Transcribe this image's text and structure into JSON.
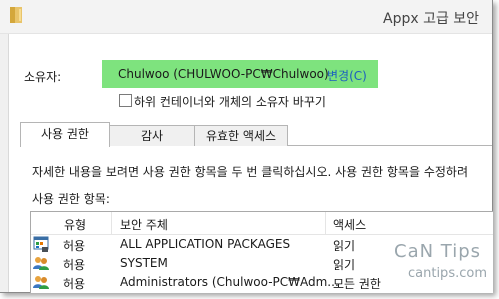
{
  "window": {
    "title": "Appx 고급 보안"
  },
  "owner": {
    "label": "소유자:",
    "value": "Chulwoo (CHULWOO-PC₩Chulwoo)",
    "change_link": "변경(C)",
    "highlight_color": "#7ee37e"
  },
  "replace_owner_checkbox": {
    "label": "하위 컨테이너와 개체의 소유자 바꾸기",
    "checked": false
  },
  "tabs": [
    {
      "label": "사용 권한",
      "active": true
    },
    {
      "label": "감사",
      "active": false
    },
    {
      "label": "유효한 액세스",
      "active": false
    }
  ],
  "instructions": "자세한 내용을 보려면 사용 권한 항목을 두 번 클릭하십시오. 사용 권한 항목을 수정하려",
  "entries_label": "사용 권한 항목:",
  "list": {
    "columns": [
      "유형",
      "보안 주체",
      "액세스"
    ],
    "rows": [
      {
        "icon": "app-packages-icon",
        "type": "허용",
        "principal": "ALL APPLICATION PACKAGES",
        "access": "읽기"
      },
      {
        "icon": "users-icon",
        "type": "허용",
        "principal": "SYSTEM",
        "access": "읽기"
      },
      {
        "icon": "users-icon",
        "type": "허용",
        "principal": "Administrators (Chulwoo-PC₩Adm...",
        "access": "모든 권한"
      }
    ]
  },
  "watermark": {
    "title": "CaN Tips",
    "url": "cantips.com"
  }
}
